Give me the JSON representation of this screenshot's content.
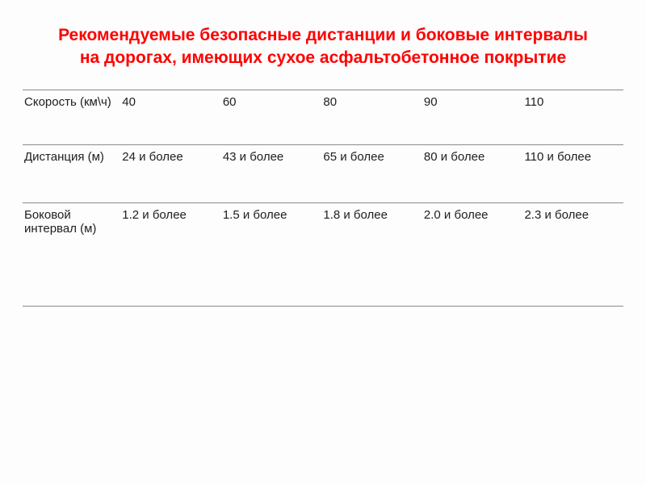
{
  "title": "Рекомендуемые безопасные дистанции и боковые интервалы на дорогах, имеющих сухое асфальтобетонное покрытие",
  "table": {
    "row_labels": [
      "Скорость (км\\ч)",
      "Дистанция (м)",
      "Боковой интервал (м)"
    ],
    "speed_row": [
      "40",
      "60",
      "80",
      "90",
      "110"
    ],
    "distance_row": [
      "24 и более",
      "43 и более",
      "65 и более",
      "80 и более",
      "110 и более"
    ],
    "lateral_row": [
      "1.2 и более",
      "1.5 и более",
      "1.8 и более",
      "2.0 и более",
      "2.3 и более"
    ]
  },
  "chart_data": {
    "type": "table",
    "title": "Рекомендуемые безопасные дистанции и боковые интервалы на дорогах, имеющих сухое асфальтобетонное покрытие",
    "categories": [
      "40",
      "60",
      "80",
      "90",
      "110"
    ],
    "xlabel": "Скорость (км\\ч)",
    "series": [
      {
        "name": "Дистанция (м), и более",
        "values": [
          24,
          43,
          65,
          80,
          110
        ]
      },
      {
        "name": "Боковой интервал (м), и более",
        "values": [
          1.2,
          1.5,
          1.8,
          2.0,
          2.3
        ]
      }
    ]
  }
}
